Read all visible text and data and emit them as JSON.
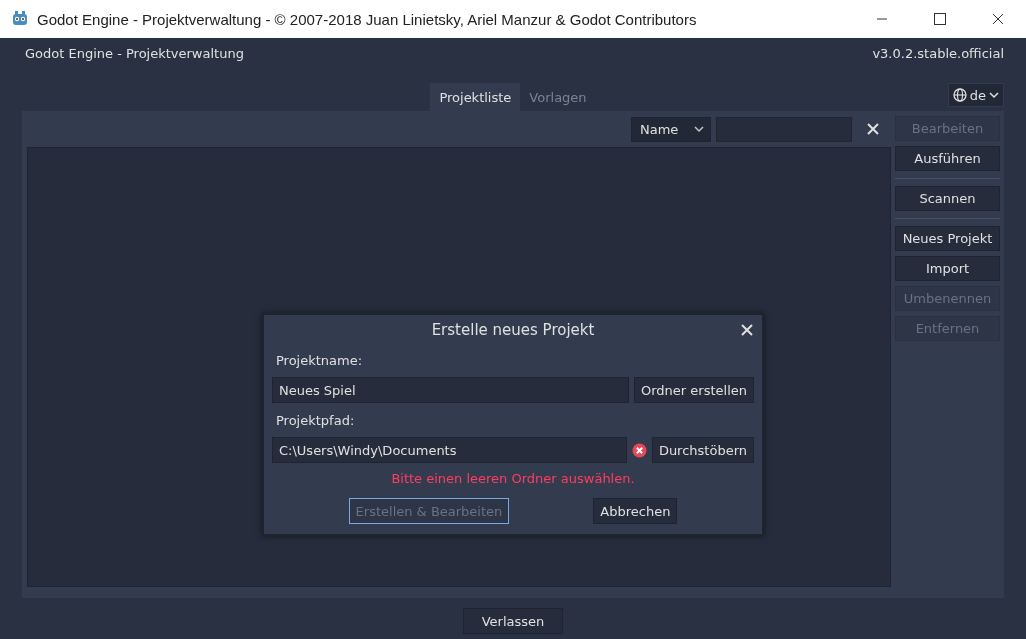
{
  "window": {
    "title": "Godot Engine - Projektverwaltung - © 2007-2018 Juan Linietsky, Ariel Manzur & Godot Contributors"
  },
  "header": {
    "title": "Godot Engine - Projektverwaltung",
    "version": "v3.0.2.stable.official"
  },
  "tabs": [
    {
      "label": "Projektliste",
      "selected": true
    },
    {
      "label": "Vorlagen",
      "selected": false
    }
  ],
  "language": {
    "label": "de"
  },
  "sort": {
    "value": "Name"
  },
  "button_groups": [
    [
      {
        "label": "Bearbeiten",
        "disabled": true
      },
      {
        "label": "Ausführen",
        "disabled": false
      }
    ],
    [
      {
        "label": "Scannen",
        "disabled": false
      }
    ],
    [
      {
        "label": "Neues Projekt",
        "disabled": false
      },
      {
        "label": "Import",
        "disabled": false
      },
      {
        "label": "Umbenennen",
        "disabled": true
      },
      {
        "label": "Entfernen",
        "disabled": true
      }
    ]
  ],
  "dialog": {
    "title": "Erstelle neues Projekt",
    "name_label": "Projektname:",
    "name_value": "Neues Spiel",
    "create_folder_button": "Ordner erstellen",
    "path_label": "Projektpfad:",
    "path_value": "C:\\Users\\Windy\\Documents",
    "path_valid": false,
    "browse_button": "Durchstöbern",
    "error": "Bitte einen leeren Ordner auswählen.",
    "actions": [
      {
        "label": "Erstellen & Bearbeiten",
        "disabled": true,
        "focused": true
      },
      {
        "label": "Abbrechen",
        "disabled": false,
        "focused": false
      }
    ]
  },
  "quit_button": "Verlassen"
}
